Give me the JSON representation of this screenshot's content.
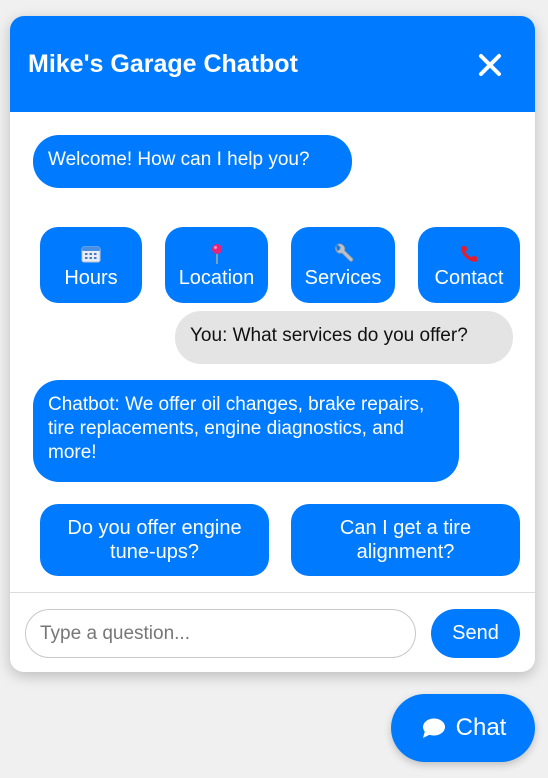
{
  "header": {
    "title": "Mike's Garage Chatbot",
    "close_icon": "close-icon"
  },
  "messages": [
    {
      "sender": "bot",
      "text": "Welcome! How can I help you?"
    },
    {
      "sender": "user",
      "text": "You: What services do you offer?"
    },
    {
      "sender": "bot",
      "text": "Chatbot: We offer oil changes, brake repairs, tire replacements, engine diagnostics, and more!"
    }
  ],
  "quick_replies": [
    {
      "label": "Hours",
      "icon": "calendar-icon"
    },
    {
      "label": "Location",
      "icon": "pushpin-icon"
    },
    {
      "label": "Services",
      "icon": "wrench-icon"
    },
    {
      "label": "Contact",
      "icon": "phone-icon"
    }
  ],
  "suggestions": [
    {
      "label": "Do you offer engine tune-ups?"
    },
    {
      "label": "Can I get a tire alignment?"
    }
  ],
  "composer": {
    "placeholder": "Type a question...",
    "value": "",
    "send_label": "Send"
  },
  "launcher": {
    "label": "Chat",
    "icon": "speech-bubble-icon"
  },
  "colors": {
    "accent": "#007bff",
    "user_bubble": "#e4e4e4",
    "background": "#f0f0f0"
  }
}
